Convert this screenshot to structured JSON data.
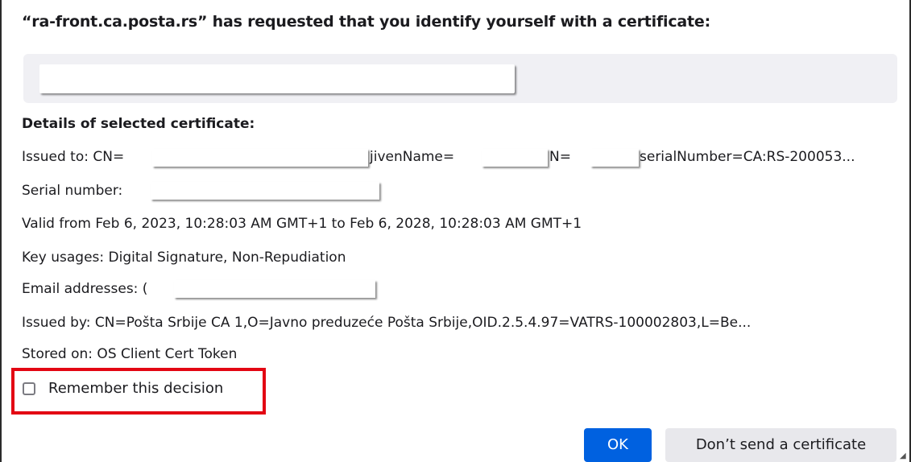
{
  "dialog": {
    "title": "“ra-front.ca.posta.rs” has requested that you identify yourself with a certificate:",
    "details_heading": "Details of selected certificate:",
    "issued_to": {
      "prefix": "Issued to: CN=",
      "given_name": "jivenName=",
      "sn": "N=",
      "serial_number": "serialNumber=CA:RS-200053..."
    },
    "serial_number_label": "Serial number:",
    "valid": "Valid from Feb 6, 2023, 10:28:03 AM GMT+1 to Feb 6, 2028, 10:28:03 AM GMT+1",
    "key_usages": "Key usages: Digital Signature, Non-Repudiation",
    "email_label": "Email addresses: (",
    "issued_by": "Issued by: CN=Pošta Srbije CA 1,O=Javno preduzeće Pošta Srbije,OID.2.5.4.97=VATRS-100002803,L=Be...",
    "stored_on": "Stored on: OS Client Cert Token",
    "remember_label": "Remember this decision",
    "remember_checked": false,
    "ok_label": "OK",
    "cancel_label": "Don’t send a certificate"
  },
  "colors": {
    "primary_button": "#0061e0",
    "highlight_box": "#e30613",
    "list_background": "#f0f0f4"
  }
}
